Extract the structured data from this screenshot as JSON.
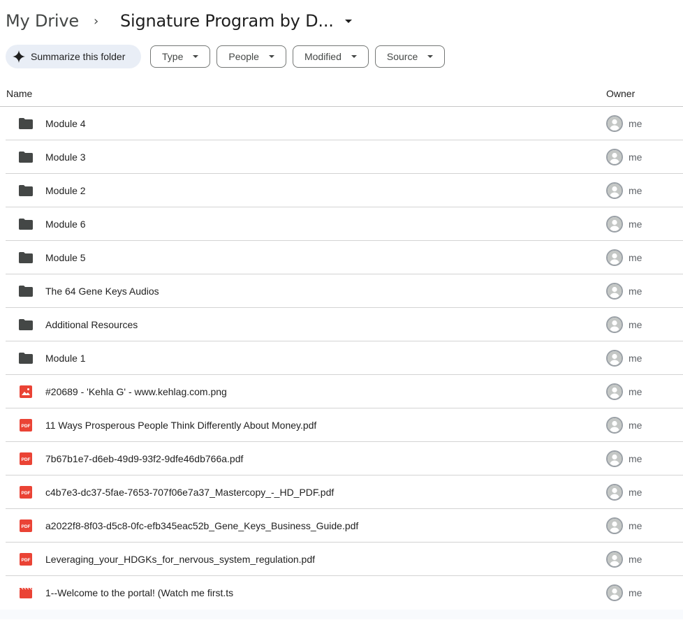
{
  "breadcrumb": {
    "root": "My Drive",
    "separator": "›",
    "current": "Signature Program by D..."
  },
  "filters": {
    "summarize_label": "Summarize this folder",
    "chips": [
      {
        "label": "Type"
      },
      {
        "label": "People"
      },
      {
        "label": "Modified"
      },
      {
        "label": "Source"
      }
    ]
  },
  "table": {
    "columns": {
      "name": "Name",
      "owner": "Owner"
    },
    "rows": [
      {
        "name": "Module 4",
        "type": "folder",
        "owner": "me"
      },
      {
        "name": "Module 3",
        "type": "folder",
        "owner": "me"
      },
      {
        "name": "Module 2",
        "type": "folder",
        "owner": "me"
      },
      {
        "name": "Module 6",
        "type": "folder",
        "owner": "me"
      },
      {
        "name": "Module 5",
        "type": "folder",
        "owner": "me"
      },
      {
        "name": "The 64 Gene Keys Audios",
        "type": "folder",
        "owner": "me"
      },
      {
        "name": "Additional Resources",
        "type": "folder",
        "owner": "me"
      },
      {
        "name": "Module 1",
        "type": "folder",
        "owner": "me"
      },
      {
        "name": "#20689 - 'Kehla G' - www.kehlag.com.png",
        "type": "image",
        "owner": "me"
      },
      {
        "name": "11 Ways Prosperous People Think Differently About Money.pdf",
        "type": "pdf",
        "owner": "me"
      },
      {
        "name": "7b67b1e7-d6eb-49d9-93f2-9dfe46db766a.pdf",
        "type": "pdf",
        "owner": "me"
      },
      {
        "name": "c4b7e3-dc37-5fae-7653-707f06e7a37_Mastercopy_-_HD_PDF.pdf",
        "type": "pdf",
        "owner": "me"
      },
      {
        "name": "a2022f8-8f03-d5c8-0fc-efb345eac52b_Gene_Keys_Business_Guide.pdf",
        "type": "pdf",
        "owner": "me"
      },
      {
        "name": "Leveraging_your_HDGKs_for_nervous_system_regulation.pdf",
        "type": "pdf",
        "owner": "me"
      },
      {
        "name": "1--Welcome to the portal! (Watch me first.ts",
        "type": "video",
        "owner": "me"
      }
    ]
  },
  "icons": {
    "folder": "folder-icon",
    "image": "image-file-icon",
    "pdf": "pdf-file-icon",
    "video": "video-file-icon",
    "avatar": "account-avatar-icon",
    "sparkle": "sparkle-icon"
  },
  "pdf_badge_text": "PDF",
  "colors": {
    "folder": "#444746",
    "file_red": "#ea4335",
    "chip_bg": "#e9eef6",
    "divider": "#d3d3d3"
  }
}
